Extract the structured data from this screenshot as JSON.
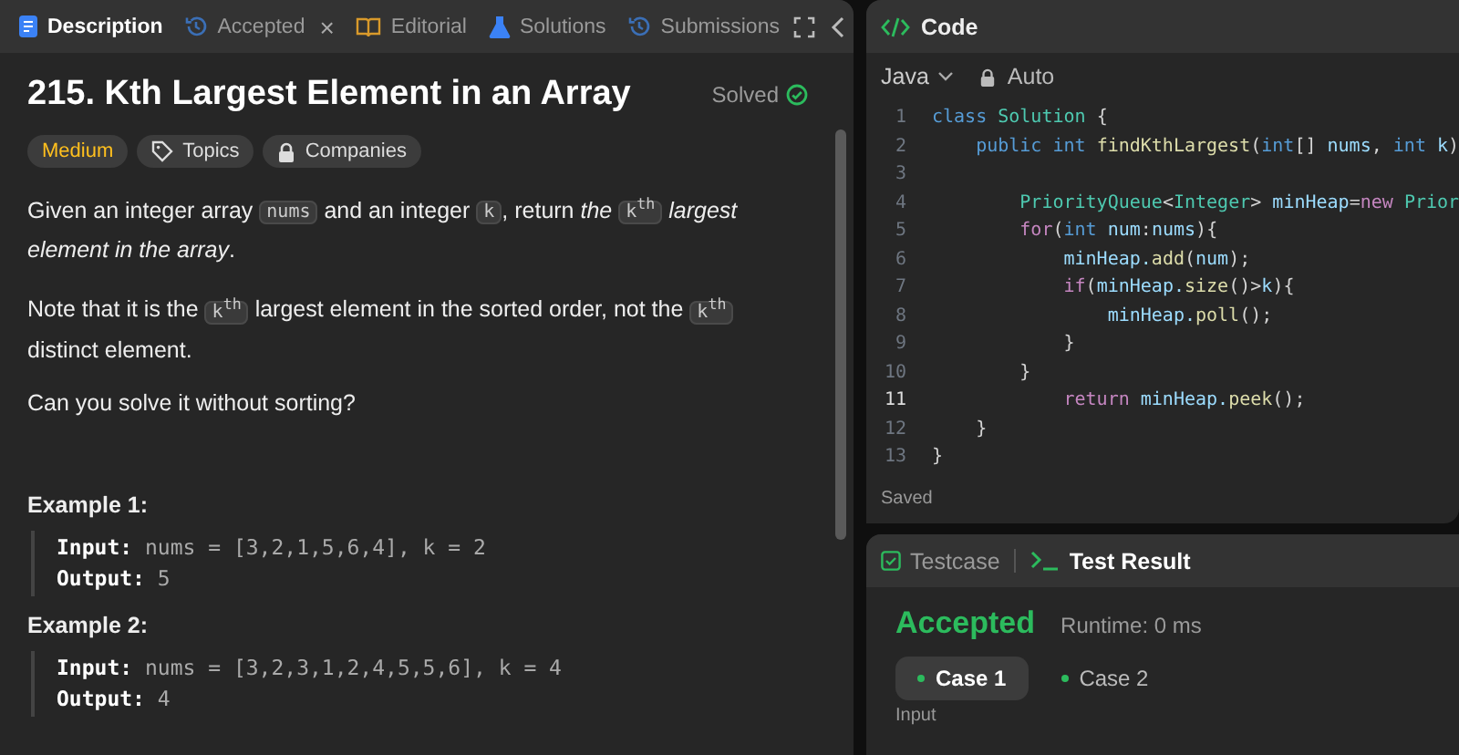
{
  "description_panel": {
    "tabs": [
      {
        "label": "Description",
        "kind": "description",
        "selected": true
      },
      {
        "label": "Accepted",
        "kind": "accepted",
        "selected": false,
        "close_label": "×"
      },
      {
        "label": "Editorial",
        "kind": "editorial",
        "selected": false
      },
      {
        "label": "Solutions",
        "kind": "solutions",
        "selected": false
      },
      {
        "label": "Submissions",
        "kind": "submissions",
        "selected": false
      }
    ],
    "title": "215. Kth Largest Element in an Array",
    "status": "Solved",
    "tags": [
      {
        "label": "Medium",
        "kind": "difficulty"
      },
      {
        "label": "Topics",
        "kind": "topics"
      },
      {
        "label": "Companies",
        "kind": "companies"
      }
    ],
    "paragraphs": [
      [
        {
          "kind": "text",
          "text": "Given an integer array "
        },
        {
          "kind": "code",
          "text": "nums"
        },
        {
          "kind": "text",
          "text": " and an integer "
        },
        {
          "kind": "code",
          "text": "k"
        },
        {
          "kind": "text",
          "text": ", return "
        },
        {
          "kind": "italic",
          "text": "the "
        },
        {
          "kind": "code",
          "text": "k$^{th}$"
        },
        {
          "kind": "italic",
          "text": " largest element in the array"
        },
        {
          "kind": "text",
          "text": "."
        }
      ],
      [
        {
          "kind": "text",
          "text": "Note that it is the "
        },
        {
          "kind": "code",
          "text": "k$^{th}$"
        },
        {
          "kind": "text",
          "text": " largest element in the sorted order, not the "
        },
        {
          "kind": "code",
          "text": "k$^{th}$"
        },
        {
          "kind": "text",
          "text": " distinct element."
        }
      ],
      [
        {
          "kind": "text",
          "text": "Can you solve it without sorting?"
        }
      ]
    ],
    "examples": [
      {
        "title": "Example 1:",
        "input_label": "Input:",
        "input": "nums = [3,2,1,5,6,4], k = 2",
        "output_label": "Output:",
        "output": "5"
      },
      {
        "title": "Example 2:",
        "input_label": "Input:",
        "input": "nums = [3,2,3,1,2,4,5,5,6], k = 4",
        "output_label": "Output:",
        "output": "4"
      }
    ]
  },
  "code_panel": {
    "title": "Code",
    "language": "Java",
    "mode": "Auto",
    "status": "Saved",
    "lines": [
      {
        "number": "1",
        "current": false,
        "tokens": [
          {
            "kind": "keyword",
            "text": "class "
          },
          {
            "kind": "type",
            "text": "Solution"
          },
          {
            "kind": "plain",
            "text": " {"
          }
        ]
      },
      {
        "number": "2",
        "current": false,
        "tokens": [
          {
            "kind": "keyword",
            "text": "    public int "
          },
          {
            "kind": "method",
            "text": "findKthLargest"
          },
          {
            "kind": "plain",
            "text": "("
          },
          {
            "kind": "keyword",
            "text": "int"
          },
          {
            "kind": "plain",
            "text": "[] "
          },
          {
            "kind": "ident",
            "text": "nums"
          },
          {
            "kind": "plain",
            "text": ", "
          },
          {
            "kind": "keyword",
            "text": "int "
          },
          {
            "kind": "ident",
            "text": "k"
          },
          {
            "kind": "plain",
            "text": ")"
          }
        ]
      },
      {
        "number": "3",
        "current": false
      },
      {
        "number": "4",
        "current": false,
        "tokens": [
          {
            "kind": "type",
            "text": "        PriorityQueue"
          },
          {
            "kind": "plain",
            "text": "<"
          },
          {
            "kind": "type",
            "text": "Integer"
          },
          {
            "kind": "plain",
            "text": "> "
          },
          {
            "kind": "ident",
            "text": "minHeap"
          },
          {
            "kind": "plain",
            "text": "="
          },
          {
            "kind": "control",
            "text": "new "
          },
          {
            "kind": "type",
            "text": "Prior"
          }
        ]
      },
      {
        "number": "5",
        "current": false,
        "tokens": [
          {
            "kind": "control",
            "text": "        for"
          },
          {
            "kind": "plain",
            "text": "("
          },
          {
            "kind": "keyword",
            "text": "int "
          },
          {
            "kind": "ident",
            "text": "num"
          },
          {
            "kind": "plain",
            "text": ":"
          },
          {
            "kind": "ident",
            "text": "nums"
          },
          {
            "kind": "plain",
            "text": "){"
          }
        ]
      },
      {
        "number": "6",
        "current": false,
        "tokens": [
          {
            "kind": "ident",
            "text": "            minHeap."
          },
          {
            "kind": "method",
            "text": "add"
          },
          {
            "kind": "plain",
            "text": "("
          },
          {
            "kind": "ident",
            "text": "num"
          },
          {
            "kind": "plain",
            "text": ");"
          }
        ]
      },
      {
        "number": "7",
        "current": false,
        "tokens": [
          {
            "kind": "control",
            "text": "            if"
          },
          {
            "kind": "plain",
            "text": "("
          },
          {
            "kind": "ident",
            "text": "minHeap."
          },
          {
            "kind": "method",
            "text": "size"
          },
          {
            "kind": "plain",
            "text": "()>"
          },
          {
            "kind": "ident",
            "text": "k"
          },
          {
            "kind": "plain",
            "text": "){"
          }
        ]
      },
      {
        "number": "8",
        "current": false,
        "tokens": [
          {
            "kind": "ident",
            "text": "                minHeap."
          },
          {
            "kind": "method",
            "text": "poll"
          },
          {
            "kind": "plain",
            "text": "();"
          }
        ]
      },
      {
        "number": "9",
        "current": false,
        "tokens": [
          {
            "kind": "plain",
            "text": "            }"
          }
        ]
      },
      {
        "number": "10",
        "current": false,
        "tokens": [
          {
            "kind": "plain",
            "text": "        }"
          }
        ]
      },
      {
        "number": "11",
        "current": true,
        "tokens": [
          {
            "kind": "control",
            "text": "            return "
          },
          {
            "kind": "ident",
            "text": "minHeap."
          },
          {
            "kind": "method",
            "text": "peek"
          },
          {
            "kind": "plain",
            "text": "();"
          }
        ]
      },
      {
        "number": "12",
        "current": false,
        "tokens": [
          {
            "kind": "plain",
            "text": "    }"
          }
        ]
      },
      {
        "number": "13",
        "current": false,
        "tokens": [
          {
            "kind": "plain",
            "text": "}"
          }
        ]
      }
    ]
  },
  "result_panel": {
    "tabs": [
      {
        "label": "Testcase",
        "kind": "testcase",
        "selected": false
      },
      {
        "label": "Test Result",
        "kind": "result",
        "selected": true
      }
    ],
    "verdict": "Accepted",
    "runtime": "Runtime: 0 ms",
    "cases": [
      {
        "label": "Case 1",
        "selected": true
      },
      {
        "label": "Case 2",
        "selected": false
      }
    ],
    "section_label": "Input"
  }
}
